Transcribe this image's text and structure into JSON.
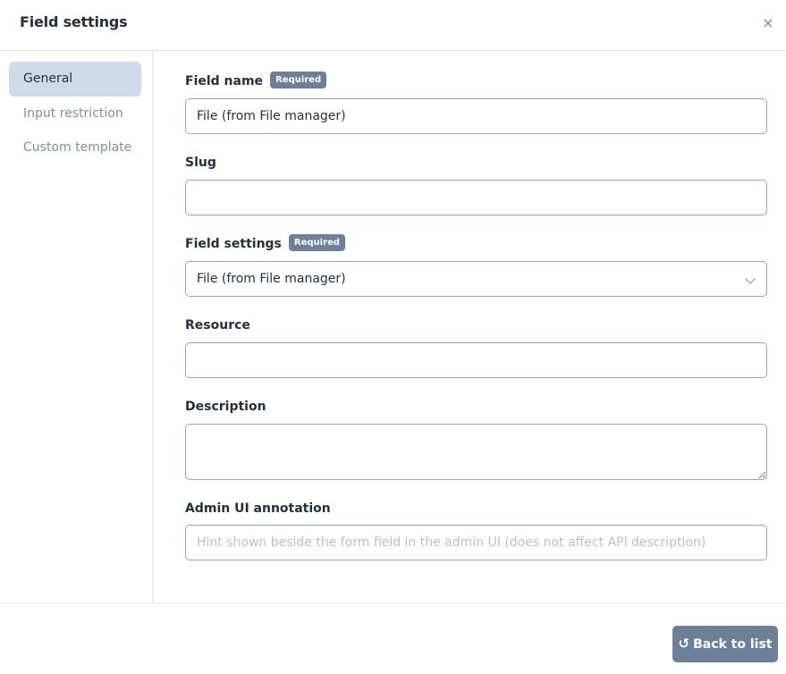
{
  "header": {
    "title": "Field settings",
    "close_glyph": "×"
  },
  "sidebar": {
    "items": [
      {
        "label": "General",
        "active": true
      },
      {
        "label": "Input restriction",
        "active": false
      },
      {
        "label": "Custom template",
        "active": false
      }
    ]
  },
  "form": {
    "field_name": {
      "label": "Field name",
      "badge": "Required",
      "value": "File (from File manager)"
    },
    "slug": {
      "label": "Slug",
      "value": ""
    },
    "field_settings": {
      "label": "Field settings",
      "badge": "Required",
      "selected": "File (from File manager)"
    },
    "resource": {
      "label": "Resource",
      "value": ""
    },
    "description": {
      "label": "Description",
      "value": ""
    },
    "admin_ui_annotation": {
      "label": "Admin UI annotation",
      "placeholder": "Hint shown beside the form field in the admin UI (does not affect API description)",
      "value": ""
    }
  },
  "footer": {
    "back_label": "Back to list",
    "back_icon": "↺"
  },
  "colors": {
    "accent": "#6e7f99",
    "active_nav_bg": "#cfdbe8",
    "input_border": "#8fa7c2"
  }
}
